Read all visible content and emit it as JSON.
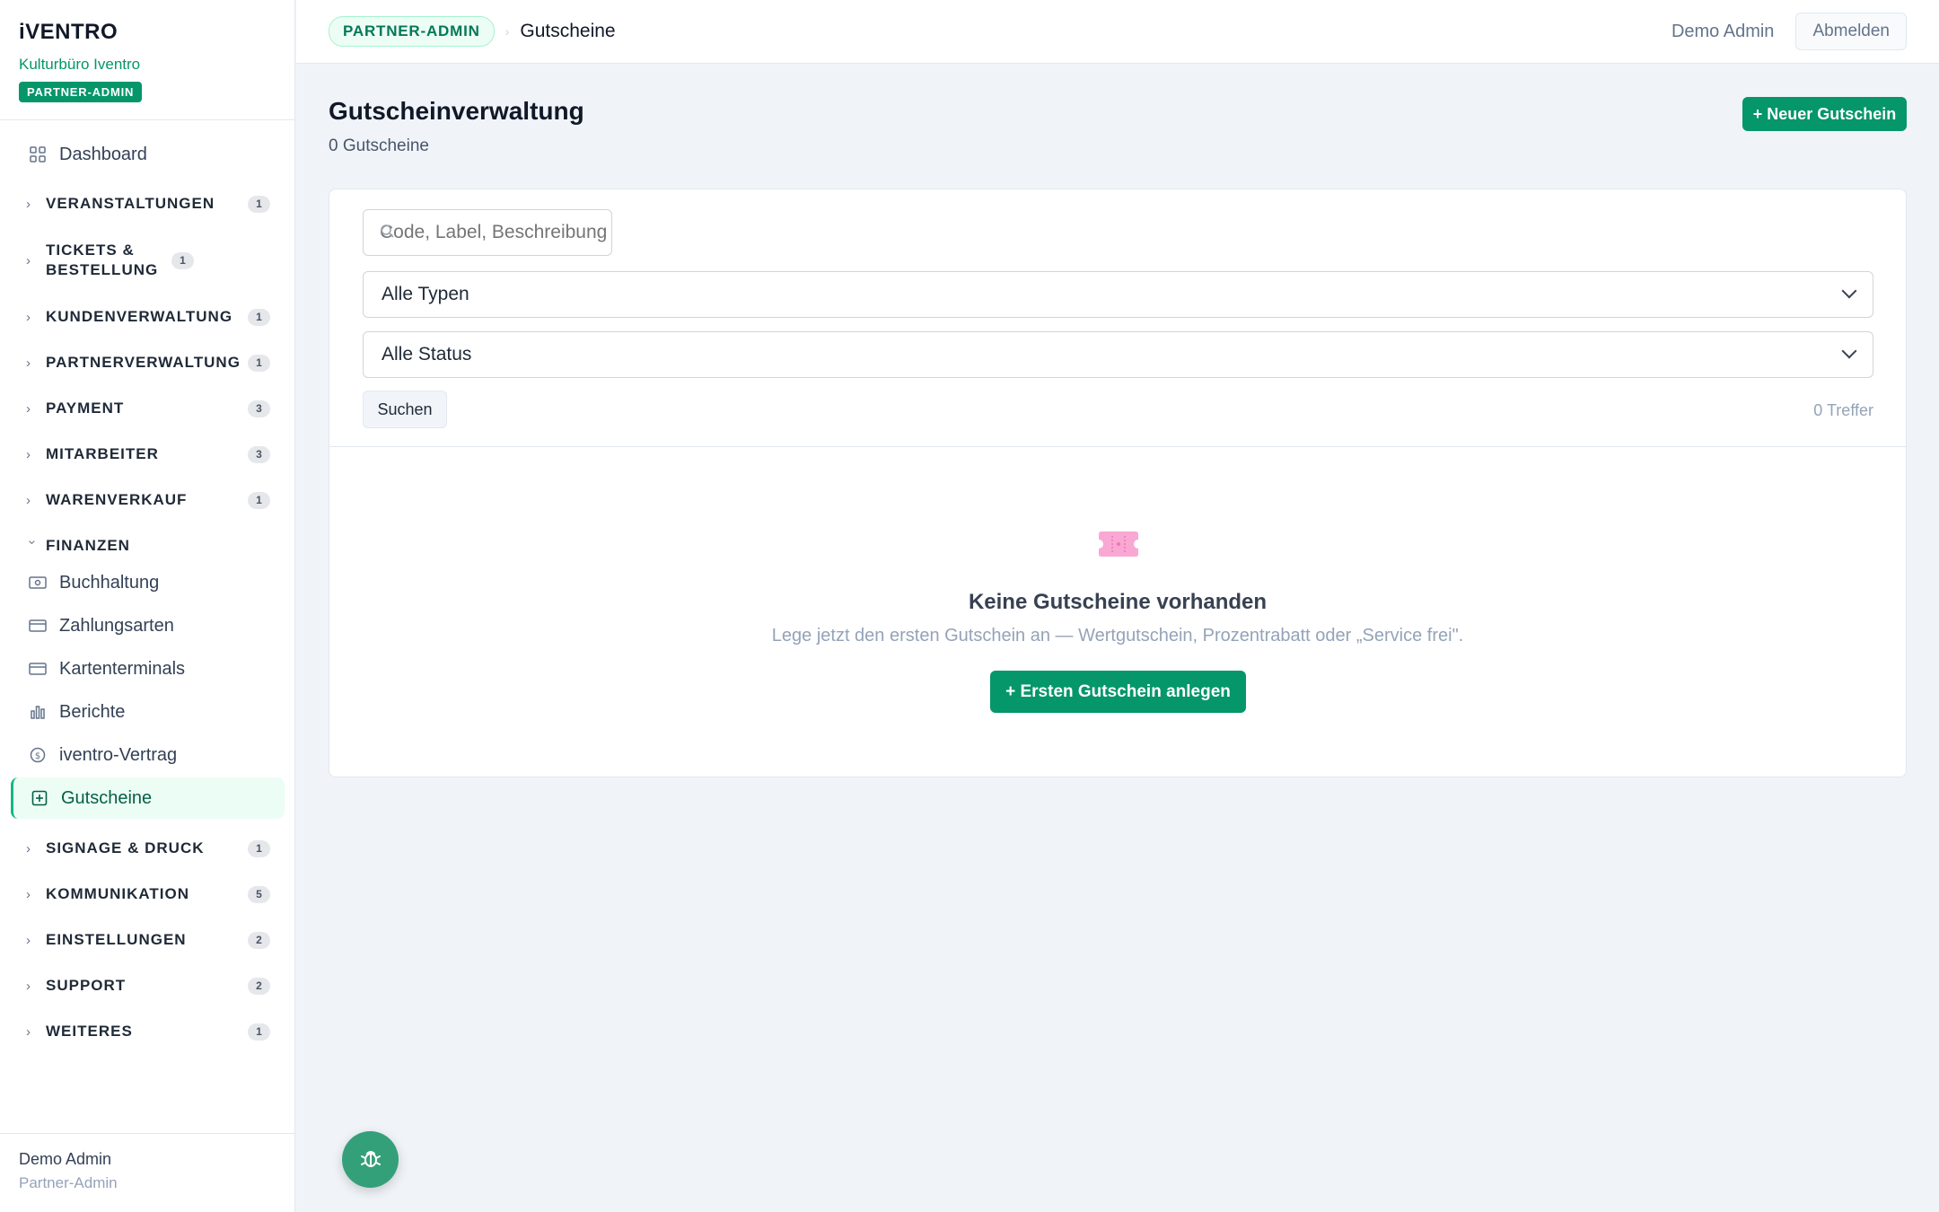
{
  "brand": {
    "logo": "iVENTRO",
    "org": "Kulturbüro Iventro",
    "badge": "PARTNER-ADMIN"
  },
  "sidebar": {
    "dashboard": "Dashboard",
    "groups": [
      {
        "label": "VERANSTALTUNGEN",
        "count": "1"
      },
      {
        "label": "TICKETS & BESTELLUNG",
        "count": "1"
      },
      {
        "label": "KUNDENVERWALTUNG",
        "count": "1"
      },
      {
        "label": "PARTNERVERWALTUNG",
        "count": "1"
      },
      {
        "label": "PAYMENT",
        "count": "3"
      },
      {
        "label": "MITARBEITER",
        "count": "3"
      },
      {
        "label": "WARENVERKAUF",
        "count": "1"
      },
      {
        "label": "FINANZEN"
      },
      {
        "label": "SIGNAGE & DRUCK",
        "count": "1"
      },
      {
        "label": "KOMMUNIKATION",
        "count": "5"
      },
      {
        "label": "EINSTELLUNGEN",
        "count": "2"
      },
      {
        "label": "SUPPORT",
        "count": "2"
      },
      {
        "label": "WEITERES",
        "count": "1"
      }
    ],
    "finanzen_items": [
      {
        "label": "Buchhaltung",
        "icon": "money-icon"
      },
      {
        "label": "Zahlungsarten",
        "icon": "credit-card-icon"
      },
      {
        "label": "Kartenterminals",
        "icon": "card-terminal-icon"
      },
      {
        "label": "Berichte",
        "icon": "chart-icon"
      },
      {
        "label": "iventro-Vertrag",
        "icon": "dollar-circle-icon"
      },
      {
        "label": "Gutscheine",
        "icon": "voucher-icon",
        "active": true
      }
    ],
    "footer": {
      "name": "Demo Admin",
      "role": "Partner-Admin"
    }
  },
  "topbar": {
    "badge": "PARTNER-ADMIN",
    "separator": "›",
    "title": "Gutscheine",
    "user": "Demo Admin",
    "logout": "Abmelden"
  },
  "main": {
    "title": "Gutscheinverwaltung",
    "subtitle": "0 Gutscheine",
    "new_button": "+ Neuer Gutschein",
    "search_placeholder": "Code, Label, Beschreibung",
    "type_select": "Alle Typen",
    "status_select": "Alle Status",
    "search_button": "Suchen",
    "hits": "0 Treffer",
    "empty_title": "Keine Gutscheine vorhanden",
    "empty_text": "Lege jetzt den ersten Gutschein an — Wertgutschein, Prozentrabatt oder „Service frei\".",
    "empty_button": "+ Ersten Gutschein anlegen"
  },
  "colors": {
    "accent": "#059669",
    "accent_light": "#ecfdf5",
    "voucher_icon": "#f472b6"
  }
}
